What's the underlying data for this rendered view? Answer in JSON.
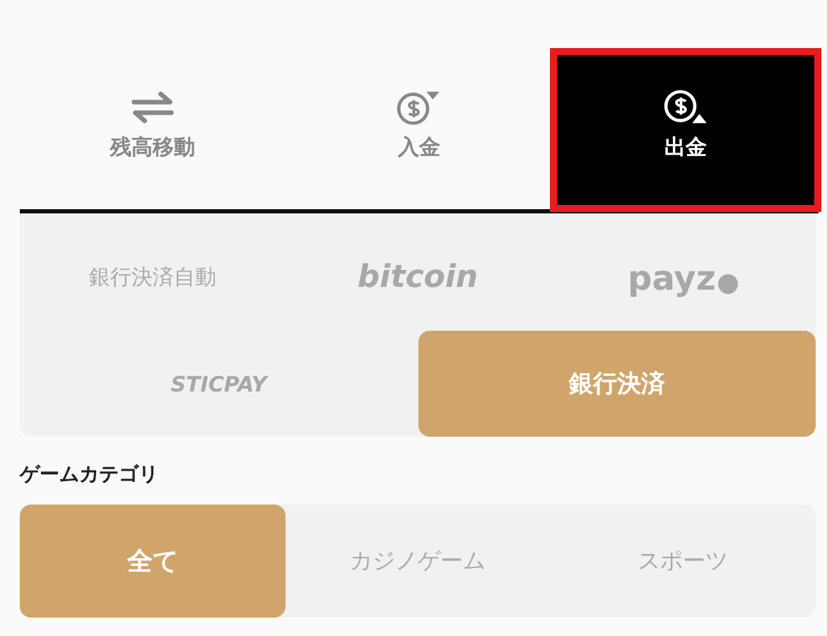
{
  "tabs": [
    {
      "label": "残高移動",
      "kind": "transfer",
      "selected": false,
      "highlighted": false
    },
    {
      "label": "入金",
      "kind": "deposit",
      "selected": false,
      "highlighted": false
    },
    {
      "label": "出金",
      "kind": "withdraw",
      "selected": true,
      "highlighted": true
    }
  ],
  "payment_methods": [
    [
      {
        "label": "銀行決済自動",
        "kind": "text",
        "selected": false
      },
      {
        "label": "bitcoin",
        "kind": "logo",
        "selected": false
      },
      {
        "label": "payz",
        "kind": "logo-dot",
        "selected": false
      }
    ],
    [
      {
        "label": "STICPAY",
        "kind": "logo-caps",
        "selected": false
      },
      {
        "label": "銀行決済",
        "kind": "text",
        "selected": true
      }
    ]
  ],
  "game_category": {
    "title": "ゲームカテゴリ",
    "options": [
      {
        "label": "全て",
        "selected": true
      },
      {
        "label": "カジノゲーム",
        "selected": false
      },
      {
        "label": "スポーツ",
        "selected": false
      }
    ]
  }
}
